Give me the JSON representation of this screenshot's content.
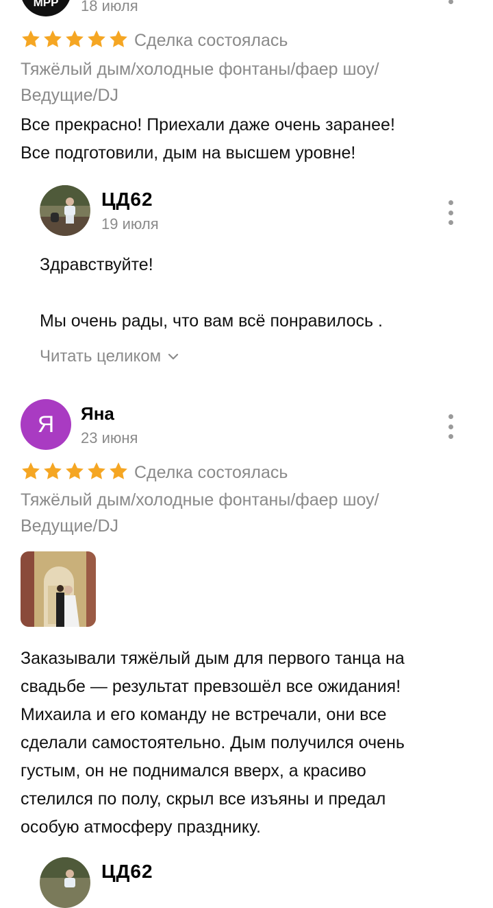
{
  "review1": {
    "avatar_text": "МРР",
    "date": "18 июля",
    "rating": 5,
    "deal_status": "Сделка состоялась",
    "tags_line1": "Тяжёлый дым/холодные фонтаны/фаер шоу/",
    "tags_line2": "Ведущие/DJ",
    "text_line1": "Все прекрасно! Приехали даже очень заранее!",
    "text_line2": "Все подготовили, дым на высшем уровне!",
    "reply": {
      "author": "ЦД62",
      "date": "19 июля",
      "text_line1": "Здравствуйте!",
      "text_line2": "Мы очень рады, что вам всё понравилось .",
      "read_more": "Читать целиком"
    }
  },
  "review2": {
    "avatar_letter": "Я",
    "author": "Яна",
    "date": "23 июня",
    "rating": 5,
    "deal_status": "Сделка состоялась",
    "tags_line1": "Тяжёлый дым/холодные фонтаны/фаер шоу/",
    "tags_line2": "Ведущие/DJ",
    "text_lines": [
      "Заказывали тяжёлый дым для первого танца на",
      "свадьбе — результат превзошёл все ожидания!",
      "Михаила и его команду не встречали, они все",
      "сделали самостоятельно. Дым получился очень",
      "густым, он не поднимался вверх, а красиво",
      "стелился по полу, скрыл все изъяны и предал",
      "особую атмосферу празднику."
    ],
    "reply": {
      "author": "ЦД62"
    }
  },
  "colors": {
    "star": "#f5a623",
    "muted_text": "#8a8a8a",
    "avatar_purple": "#a93bc2"
  },
  "icons": {
    "star": "star-icon",
    "more": "more-vertical-icon",
    "chevron": "chevron-down-icon"
  }
}
